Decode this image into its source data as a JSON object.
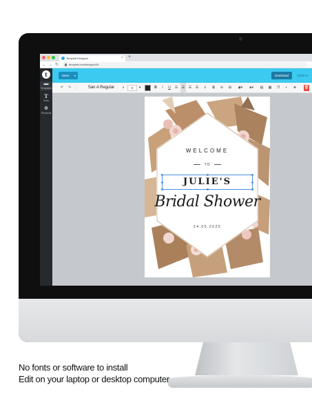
{
  "browser": {
    "tab_title": "Templett Designer",
    "new_tab": "+",
    "url": "templett.com/design/v2#",
    "nav": {
      "back": "←",
      "forward": "→",
      "reload": "↻"
    }
  },
  "sidebar": {
    "items": [
      {
        "label": "Templates",
        "icon": "template-icon"
      },
      {
        "label": "Texts",
        "icon": "text-icon"
      },
      {
        "label": "Elements",
        "icon": "elements-icon"
      }
    ]
  },
  "topbar": {
    "save_label": "Save",
    "download_label": "Download",
    "admin_label": "Admin ▾"
  },
  "toolbar": {
    "undo": "↶",
    "redo": "↷",
    "font_name": "San A Regular",
    "font_size": "8",
    "bold": "B",
    "italic": "I",
    "underline": "U"
  },
  "card": {
    "welcome": "WELCOME",
    "to": "TO",
    "name": "JULIE'S",
    "script_title": "Bridal Shower",
    "date": "24.05.2020"
  },
  "caption": {
    "line1": "No fonts or software to install",
    "line2": "Edit on your laptop or desktop computer"
  },
  "colors": {
    "accent": "#3ccaf0",
    "sidebar": "#26292e",
    "selection": "#4a90e2",
    "foliage": "#c49a74"
  }
}
